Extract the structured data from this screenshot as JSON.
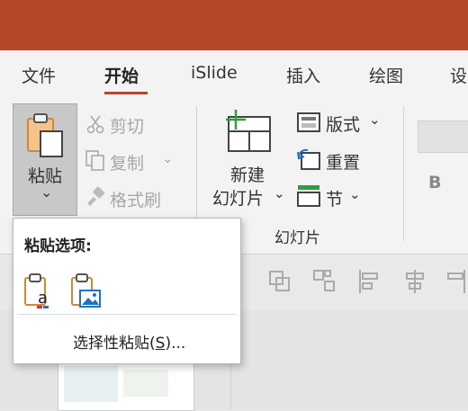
{
  "ribbon_tabs": [
    {
      "label": "文件",
      "active": false
    },
    {
      "label": "开始",
      "active": true
    },
    {
      "label": "iSlide",
      "active": false
    },
    {
      "label": "插入",
      "active": false
    },
    {
      "label": "绘图",
      "active": false
    },
    {
      "label": "设",
      "active": false
    }
  ],
  "clipboard": {
    "paste_label": "粘贴",
    "paste_arrow": "⌄",
    "cut_label": "剪切",
    "copy_label": "复制",
    "copy_arrow": "⌄",
    "format_painter_label": "格式刷"
  },
  "slides": {
    "new_slide_label_1": "新建",
    "new_slide_label_2": "幻灯片",
    "new_slide_arrow": "⌄",
    "layout_label": "版式",
    "layout_arrow": "⌄",
    "reset_label": "重置",
    "section_label": "节",
    "section_arrow": "⌄",
    "group_label": "幻灯片"
  },
  "font": {
    "bold_label": "B"
  },
  "paste_menu": {
    "title": "粘贴选项:",
    "item_label_prefix": "选择性粘贴(",
    "item_accel": "S",
    "item_label_suffix": ")..."
  },
  "colors": {
    "accent": "#b7472a",
    "ribbon_bg": "#f3f3f3"
  }
}
